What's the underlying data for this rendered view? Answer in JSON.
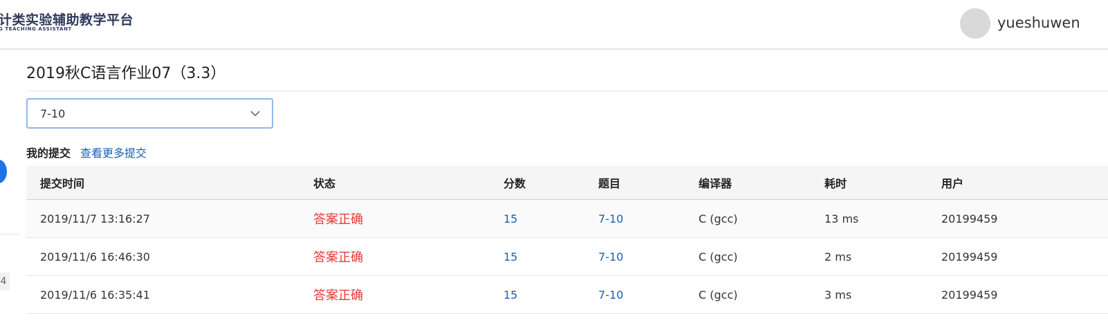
{
  "header": {
    "logo_title": "计类实验辅助教学平台",
    "logo_subtitle": "G TEACHING ASSISTANT",
    "username": "yueshuwen"
  },
  "sidebar": {
    "badge": "4"
  },
  "main": {
    "title": "2019秋C语言作业07（3.3）",
    "problem_select": {
      "value": "7-10"
    },
    "submissions_label": "我的提交",
    "more_link": "查看更多提交"
  },
  "table": {
    "columns": [
      "提交时间",
      "状态",
      "分数",
      "题目",
      "编译器",
      "耗时",
      "用户"
    ],
    "rows": [
      {
        "time": "2019/11/7 13:16:27",
        "status": "答案正确",
        "score": "15",
        "problem": "7-10",
        "compiler": "C (gcc)",
        "duration": "13 ms",
        "user": "20199459"
      },
      {
        "time": "2019/11/6 16:46:30",
        "status": "答案正确",
        "score": "15",
        "problem": "7-10",
        "compiler": "C (gcc)",
        "duration": "2 ms",
        "user": "20199459"
      },
      {
        "time": "2019/11/6 16:35:41",
        "status": "答案正确",
        "score": "15",
        "problem": "7-10",
        "compiler": "C (gcc)",
        "duration": "3 ms",
        "user": "20199459"
      }
    ]
  },
  "colors": {
    "accent_blue": "#1e5fb0",
    "status_red": "#e53935",
    "sidebar_blue": "#1e73e8"
  }
}
